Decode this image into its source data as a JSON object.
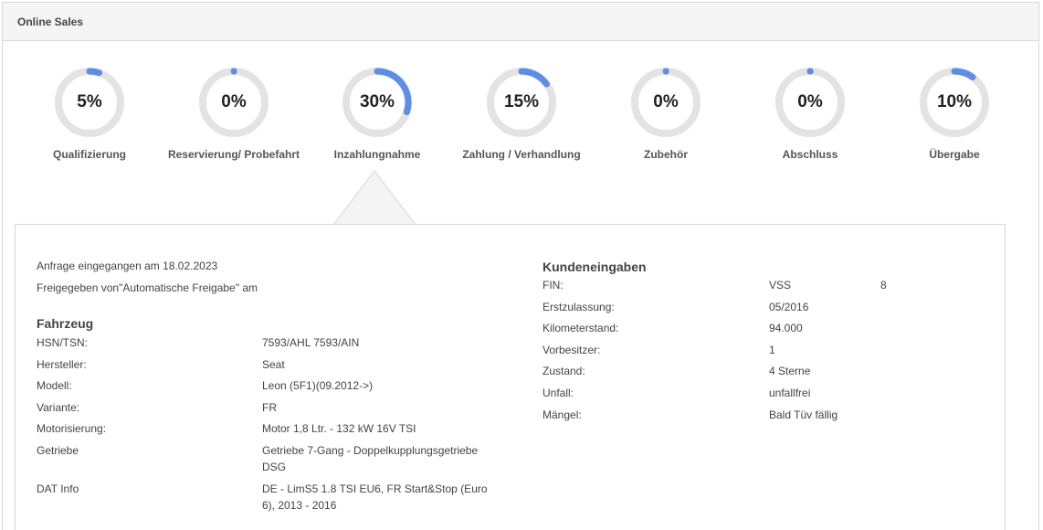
{
  "header": {
    "title": "Online Sales"
  },
  "colors": {
    "track": "#e3e3e3",
    "progress": "#5b8ee6"
  },
  "steps": [
    {
      "label": "Qualifizierung",
      "percent": 5,
      "display": "5%"
    },
    {
      "label": "Reservierung/ Probefahrt",
      "percent": 0,
      "display": "0%"
    },
    {
      "label": "Inzahlungnahme",
      "percent": 30,
      "display": "30%"
    },
    {
      "label": "Zahlung / Verhandlung",
      "percent": 15,
      "display": "15%"
    },
    {
      "label": "Zubehör",
      "percent": 0,
      "display": "0%"
    },
    {
      "label": "Abschluss",
      "percent": 0,
      "display": "0%"
    },
    {
      "label": "Übergabe",
      "percent": 10,
      "display": "10%"
    }
  ],
  "detail": {
    "request_received": "Anfrage eingegangen am 18.02.2023",
    "released_by": "Freigegeben von\"Automatische Freigabe\" am",
    "vehicle": {
      "title": "Fahrzeug",
      "rows": [
        {
          "label": "HSN/TSN:",
          "value": "7593/AHL 7593/AIN"
        },
        {
          "label": "Hersteller:",
          "value": "Seat"
        },
        {
          "label": "Modell:",
          "value": "Leon (5F1)(09.2012->)"
        },
        {
          "label": "Variante:",
          "value": "FR"
        },
        {
          "label": "Motorisierung:",
          "value": "Motor 1,8 Ltr. - 132 kW 16V TSI"
        },
        {
          "label": "Getriebe",
          "value": "Getriebe 7-Gang - Doppelkupplungsgetriebe DSG"
        },
        {
          "label": "DAT Info",
          "value": "DE - LimS5 1.8 TSI EU6, FR Start&Stop (Euro 6), 2013 - 2016"
        }
      ]
    },
    "customer": {
      "title": "Kundeneingaben",
      "fin_label": "FIN:",
      "fin_value": "VSS",
      "fin_suffix": "8",
      "rows": [
        {
          "label": "Erstzulassung:",
          "value": "05/2016"
        },
        {
          "label": "Kilometerstand:",
          "value": "94.000"
        },
        {
          "label": "Vorbesitzer:",
          "value": "1"
        },
        {
          "label": "Zustand:",
          "value": "4 Sterne"
        },
        {
          "label": "Unfall:",
          "value": "unfallfrei"
        },
        {
          "label": "Mängel:",
          "value": "Bald Tüv fällig"
        }
      ]
    }
  }
}
